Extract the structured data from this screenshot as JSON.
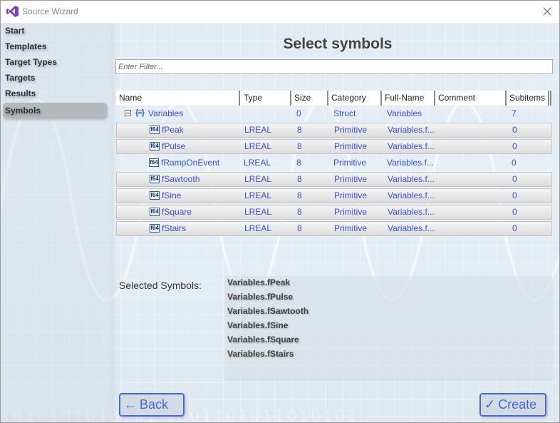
{
  "window": {
    "title": "Source Wizard",
    "close_icon": "close-icon",
    "app_icon": "visual-studio-logo-icon"
  },
  "sidebar": {
    "items": [
      {
        "label": "Start",
        "active": false
      },
      {
        "label": "Templates",
        "active": false
      },
      {
        "label": "Target Types",
        "active": false
      },
      {
        "label": "Targets",
        "active": false
      },
      {
        "label": "Results",
        "active": false
      },
      {
        "label": "Symbols",
        "active": true
      }
    ]
  },
  "main": {
    "title": "Select symbols",
    "filter": {
      "value": "",
      "placeholder": "Enter Filter..."
    },
    "table": {
      "columns": [
        "Name",
        "Type",
        "Size",
        "Category",
        "Full-Name",
        "Comment",
        "Subitems"
      ],
      "root": {
        "name": "Variables",
        "type": "",
        "size": "0",
        "category": "Struct",
        "full_name": "Variables",
        "comment": "",
        "subitems": "7",
        "expanded": true,
        "icon": "struct-icon"
      },
      "rows": [
        {
          "name": "fPeak",
          "type": "LREAL",
          "size": "8",
          "category": "Primitive",
          "full_name": "Variables.f...",
          "comment": "",
          "subitems": "0",
          "selected": true,
          "icon": "lreal-variable-icon",
          "icon_text": "f64"
        },
        {
          "name": "fPulse",
          "type": "LREAL",
          "size": "8",
          "category": "Primitive",
          "full_name": "Variables.f...",
          "comment": "",
          "subitems": "0",
          "selected": true,
          "icon": "lreal-variable-icon",
          "icon_text": "f64"
        },
        {
          "name": "fRampOnEvent",
          "type": "LREAL",
          "size": "8",
          "category": "Primitive",
          "full_name": "Variables.f...",
          "comment": "",
          "subitems": "0",
          "selected": false,
          "icon": "lreal-variable-icon",
          "icon_text": "f64"
        },
        {
          "name": "fSawtooth",
          "type": "LREAL",
          "size": "8",
          "category": "Primitive",
          "full_name": "Variables.f...",
          "comment": "",
          "subitems": "0",
          "selected": true,
          "icon": "lreal-variable-icon",
          "icon_text": "f64"
        },
        {
          "name": "fSine",
          "type": "LREAL",
          "size": "8",
          "category": "Primitive",
          "full_name": "Variables.f...",
          "comment": "",
          "subitems": "0",
          "selected": true,
          "icon": "lreal-variable-icon",
          "icon_text": "f64"
        },
        {
          "name": "fSquare",
          "type": "LREAL",
          "size": "8",
          "category": "Primitive",
          "full_name": "Variables.f...",
          "comment": "",
          "subitems": "0",
          "selected": true,
          "icon": "lreal-variable-icon",
          "icon_text": "f64"
        },
        {
          "name": "fStairs",
          "type": "LREAL",
          "size": "8",
          "category": "Primitive",
          "full_name": "Variables.f...",
          "comment": "",
          "subitems": "0",
          "selected": true,
          "icon": "lreal-variable-icon",
          "icon_text": "f64"
        }
      ]
    },
    "selected_symbols": {
      "label": "Selected Symbols:",
      "items": [
        "Variables.fPeak",
        "Variables.fPulse",
        "Variables.fSawtooth",
        "Variables.fSine",
        "Variables.fSquare",
        "Variables.fStairs"
      ]
    }
  },
  "buttons": {
    "back": {
      "label": "Back",
      "icon": "arrow-left-icon",
      "glyph": "←"
    },
    "create": {
      "label": "Create",
      "icon": "checkmark-icon",
      "glyph": "✓"
    }
  },
  "colors": {
    "accent": "#4468e0",
    "link_text": "#3a50d8",
    "active_nav": "#b4b8bd"
  }
}
